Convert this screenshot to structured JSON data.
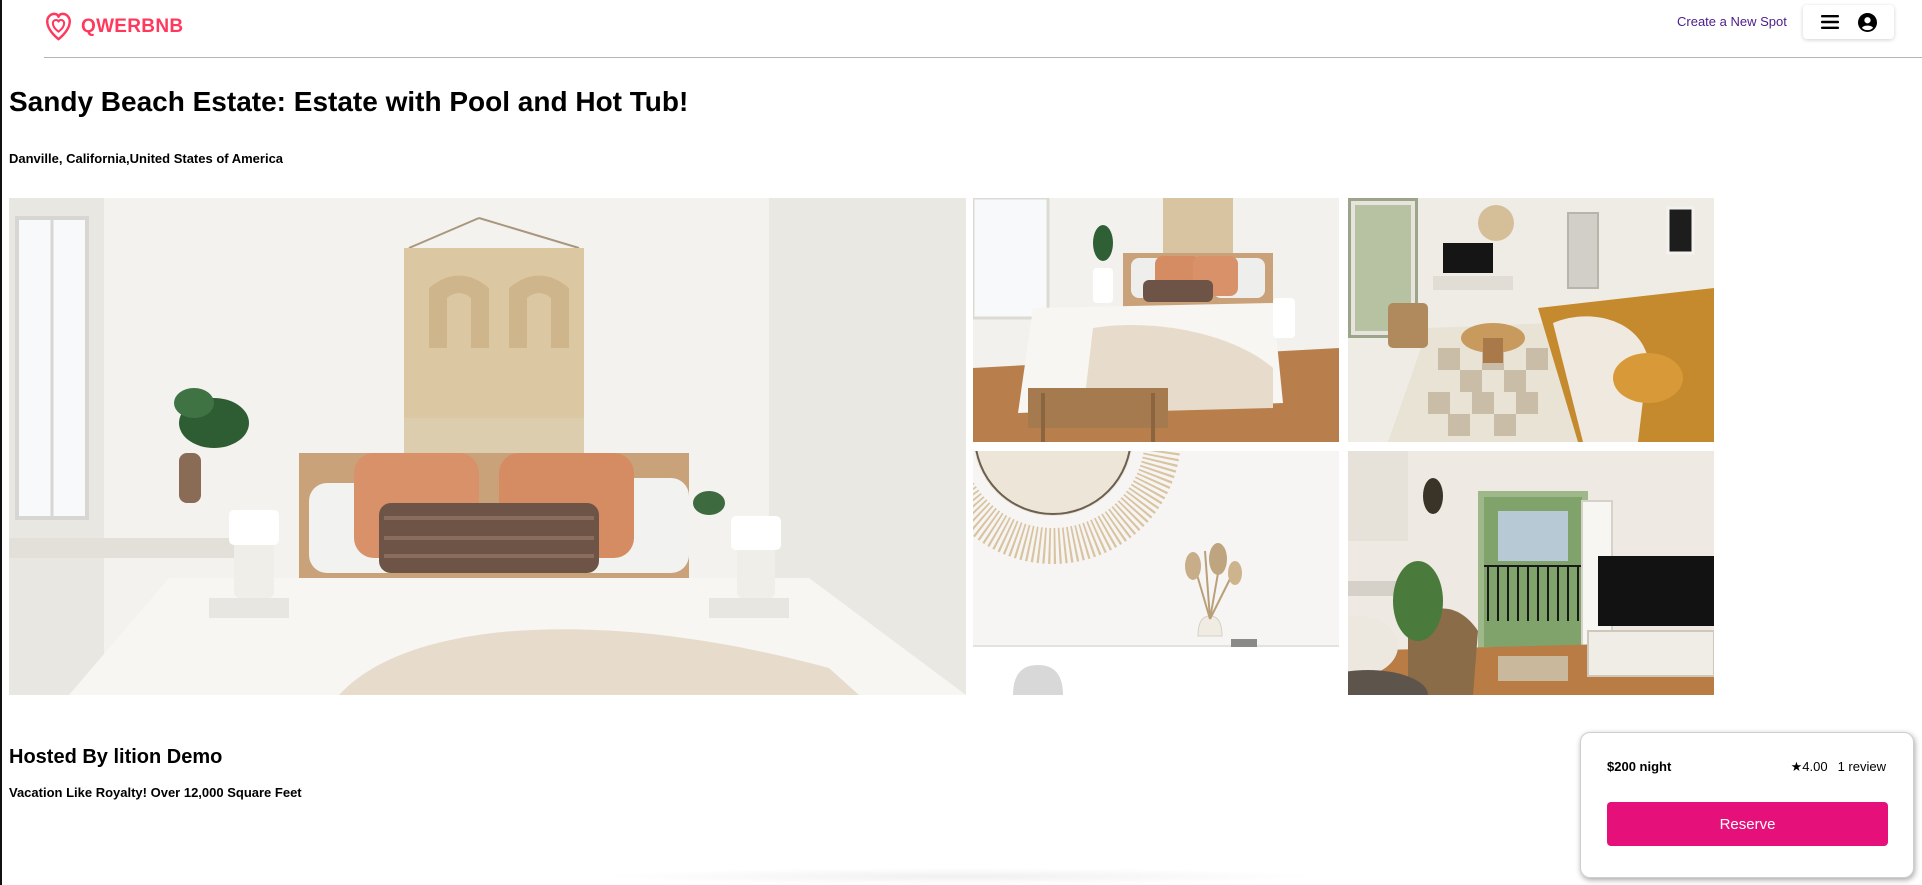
{
  "app": {
    "brand": "QWERBNB",
    "brand_color": "#ff385c",
    "logo_icon": "airbnb-logo-icon"
  },
  "nav": {
    "create_link": "Create a New Spot",
    "menu_icon": "hamburger-menu-icon",
    "profile_icon": "user-circle-icon"
  },
  "spot": {
    "title": "Sandy Beach Estate: Estate with Pool and Hot Tub!",
    "location": "Danville, California,United States of America",
    "images": [
      {
        "subject": "bedroom with macrame wall hanging and orange pillows"
      },
      {
        "subject": "bedroom with wooden bench at foot of bed"
      },
      {
        "subject": "living room with mustard sofa and checkered rug"
      },
      {
        "subject": "rattan sunburst mirror over white desk with dried flowers"
      },
      {
        "subject": "living room opening to balcony with tv stand"
      }
    ],
    "host": "Hosted By lition Demo",
    "description": "Vacation Like Royalty! Over 12,000 Square Feet"
  },
  "reserve_card": {
    "price": "$200 night",
    "rating": "★4.00",
    "reviews": "1 review",
    "button_label": "Reserve",
    "button_color": "#e6107a"
  }
}
